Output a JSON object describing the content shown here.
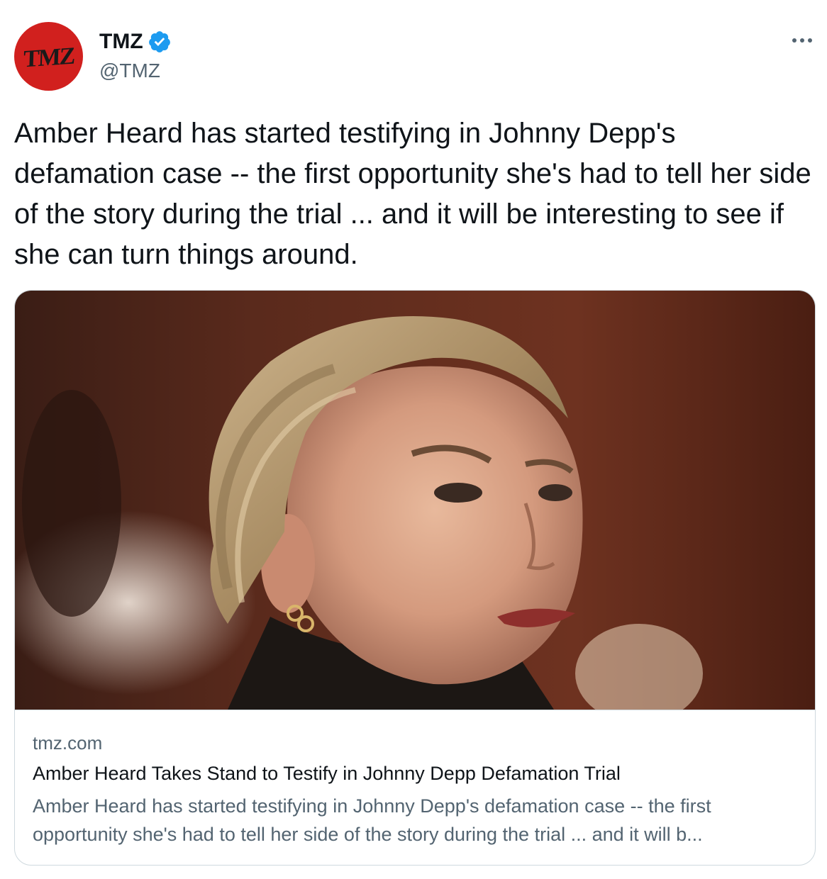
{
  "author": {
    "avatar_logo_text": "TMZ",
    "display_name": "TMZ",
    "handle": "@TMZ",
    "verified": true,
    "avatar_color": "#d1201e"
  },
  "tweet": {
    "text": "Amber Heard has started testifying in Johnny Depp's defamation case -- the first opportunity she's had to tell her side of the story during the trial ... and it will be interesting to see if she can turn things around."
  },
  "link_card": {
    "domain": "tmz.com",
    "title": "Amber Heard Takes Stand to Testify in Johnny Depp Defamation Trial",
    "description": "Amber Heard has started testifying in Johnny Depp's defamation case -- the first opportunity she's had to tell her side of the story during the trial ... and it will b..."
  },
  "icons": {
    "verified": "verified-badge-icon",
    "more": "more-options-icon"
  },
  "colors": {
    "text_primary": "#0f1419",
    "text_secondary": "#536471",
    "verified_blue": "#1d9bf0",
    "border": "#cfd9de"
  }
}
